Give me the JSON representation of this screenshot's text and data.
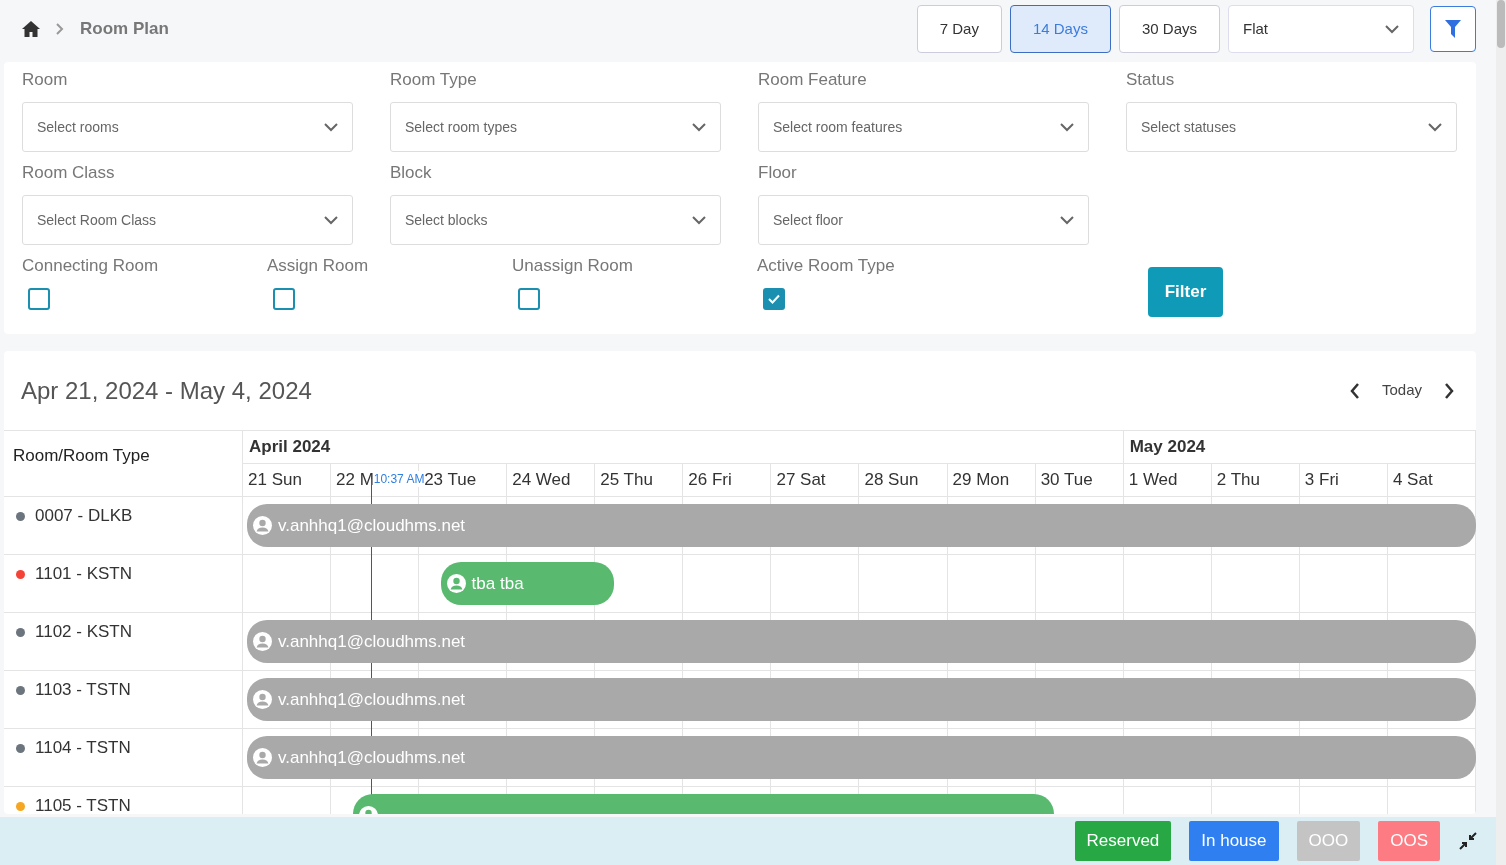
{
  "breadcrumb": {
    "title": "Room Plan"
  },
  "view_buttons": [
    {
      "label": "7 Day",
      "selected": false
    },
    {
      "label": "14 Days",
      "selected": true
    },
    {
      "label": "30 Days",
      "selected": false
    }
  ],
  "layout_select": {
    "value": "Flat"
  },
  "filters": [
    {
      "label": "Room",
      "placeholder": "Select rooms"
    },
    {
      "label": "Room Type",
      "placeholder": "Select room types"
    },
    {
      "label": "Room Feature",
      "placeholder": "Select room features"
    },
    {
      "label": "Status",
      "placeholder": "Select statuses"
    },
    {
      "label": "Room Class",
      "placeholder": "Select Room Class"
    },
    {
      "label": "Block",
      "placeholder": "Select blocks"
    },
    {
      "label": "Floor",
      "placeholder": "Select floor"
    }
  ],
  "checkboxes": [
    {
      "label": "Connecting Room",
      "checked": false
    },
    {
      "label": "Assign Room",
      "checked": false
    },
    {
      "label": "Unassign Room",
      "checked": false
    },
    {
      "label": "Active Room Type",
      "checked": true
    }
  ],
  "filter_button": "Filter",
  "calendar": {
    "range": "Apr 21, 2024 - May 4, 2024",
    "today": "Today",
    "corner": "Room/Room Type",
    "months": [
      {
        "label": "April 2024",
        "days": [
          "21 Sun",
          "22 M",
          "23 Tue",
          "24 Wed",
          "25 Thu",
          "26 Fri",
          "27 Sat",
          "28 Sun",
          "29 Mon",
          "30 Tue"
        ]
      },
      {
        "label": "May 2024",
        "days": [
          "1 Wed",
          "2 Thu",
          "3 Fri",
          "4 Sat"
        ]
      }
    ],
    "now": {
      "label": "10:37 AM",
      "level": 0.1
    },
    "rooms": [
      {
        "name": "0007 - DLKB",
        "color": "#6c757d",
        "bookings": [
          {
            "kind": "blocked",
            "guest": "v.anhhq1@cloudhms.net"
          }
        ]
      },
      {
        "name": "1101 - KSTN",
        "color": "#f44336",
        "bookings": [
          {
            "kind": "reserved",
            "guest": "tba tba"
          }
        ]
      },
      {
        "name": "1102 - KSTN",
        "color": "#6c757d",
        "bookings": [
          {
            "kind": "blocked",
            "guest": "v.anhhq1@cloudhms.net"
          }
        ]
      },
      {
        "name": "1103 - TSTN",
        "color": "#6c757d",
        "bookings": [
          {
            "kind": "blocked",
            "guest": "v.anhhq1@cloudhms.net"
          }
        ]
      },
      {
        "name": "1104 - TSTN",
        "color": "#6c757d",
        "bookings": [
          {
            "kind": "blocked",
            "guest": "v.anhhq1@cloudhms.net"
          }
        ]
      },
      {
        "name": "1105 - TSTN",
        "color": "#f5a623",
        "bookings": [
          {
            "kind": "reserved"
          }
        ]
      }
    ]
  },
  "legend": [
    {
      "label": "Reserved",
      "color": "#28a745"
    },
    {
      "label": "In house",
      "color": "#2f7ff0"
    },
    {
      "label": "OOO",
      "color": "#c4c4c4"
    },
    {
      "label": "OOS",
      "color": "#fd7c84"
    }
  ]
}
